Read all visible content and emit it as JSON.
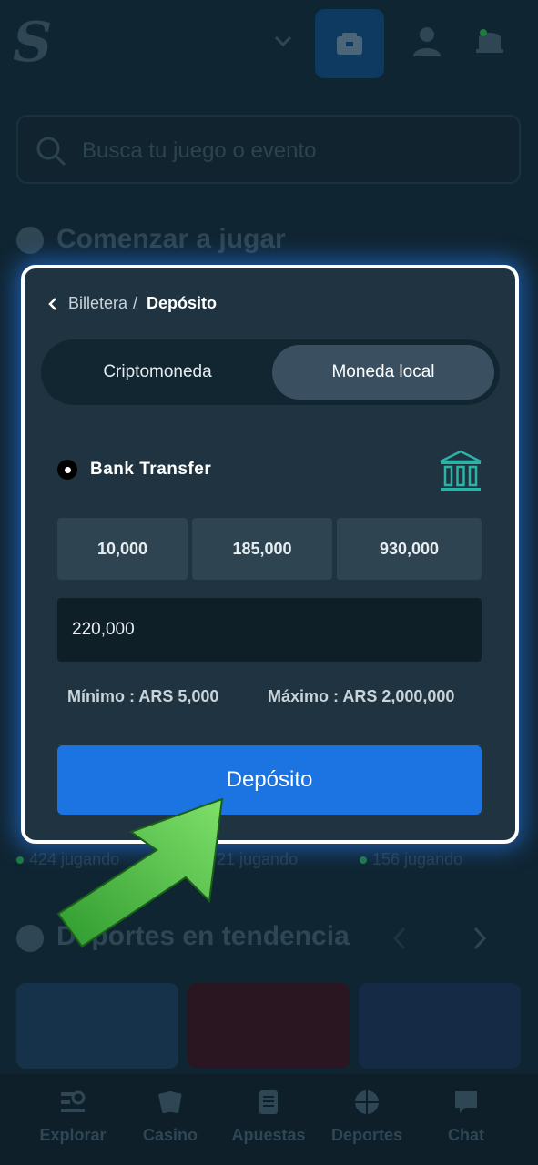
{
  "background": {
    "search_placeholder": "Busca tu juego o evento",
    "section_start": "Comenzar a jugar",
    "section_trending": "Deportes en tendencia",
    "playing": [
      "424 jugando",
      "21 jugando",
      "156 jugando"
    ],
    "bottom_nav": [
      {
        "label": "Explorar",
        "icon": "explore-icon"
      },
      {
        "label": "Casino",
        "icon": "cards-icon"
      },
      {
        "label": "Apuestas",
        "icon": "betslip-icon"
      },
      {
        "label": "Deportes",
        "icon": "basketball-icon"
      },
      {
        "label": "Chat",
        "icon": "chat-icon"
      }
    ]
  },
  "modal": {
    "breadcrumb": {
      "parent": "Billetera",
      "separator": "/",
      "current": "Depósito"
    },
    "tabs": [
      {
        "label": "Criptomoneda",
        "active": false
      },
      {
        "label": "Moneda local",
        "active": true
      }
    ],
    "method": {
      "label": "Bank Transfer",
      "selected": true,
      "icon": "bank-icon"
    },
    "presets": [
      "10,000",
      "185,000",
      "930,000"
    ],
    "amount_value": "220,000",
    "min_label": "Mínimo : ARS 5,000",
    "max_label": "Máximo : ARS 2,000,000",
    "deposit_button": "Depósito"
  },
  "colors": {
    "accent": "#1c74e3",
    "modal_bg": "#1f3440",
    "glow": "#2882ff",
    "arrow": "#3fbf3a",
    "bank_icon": "#2ab3a6"
  }
}
